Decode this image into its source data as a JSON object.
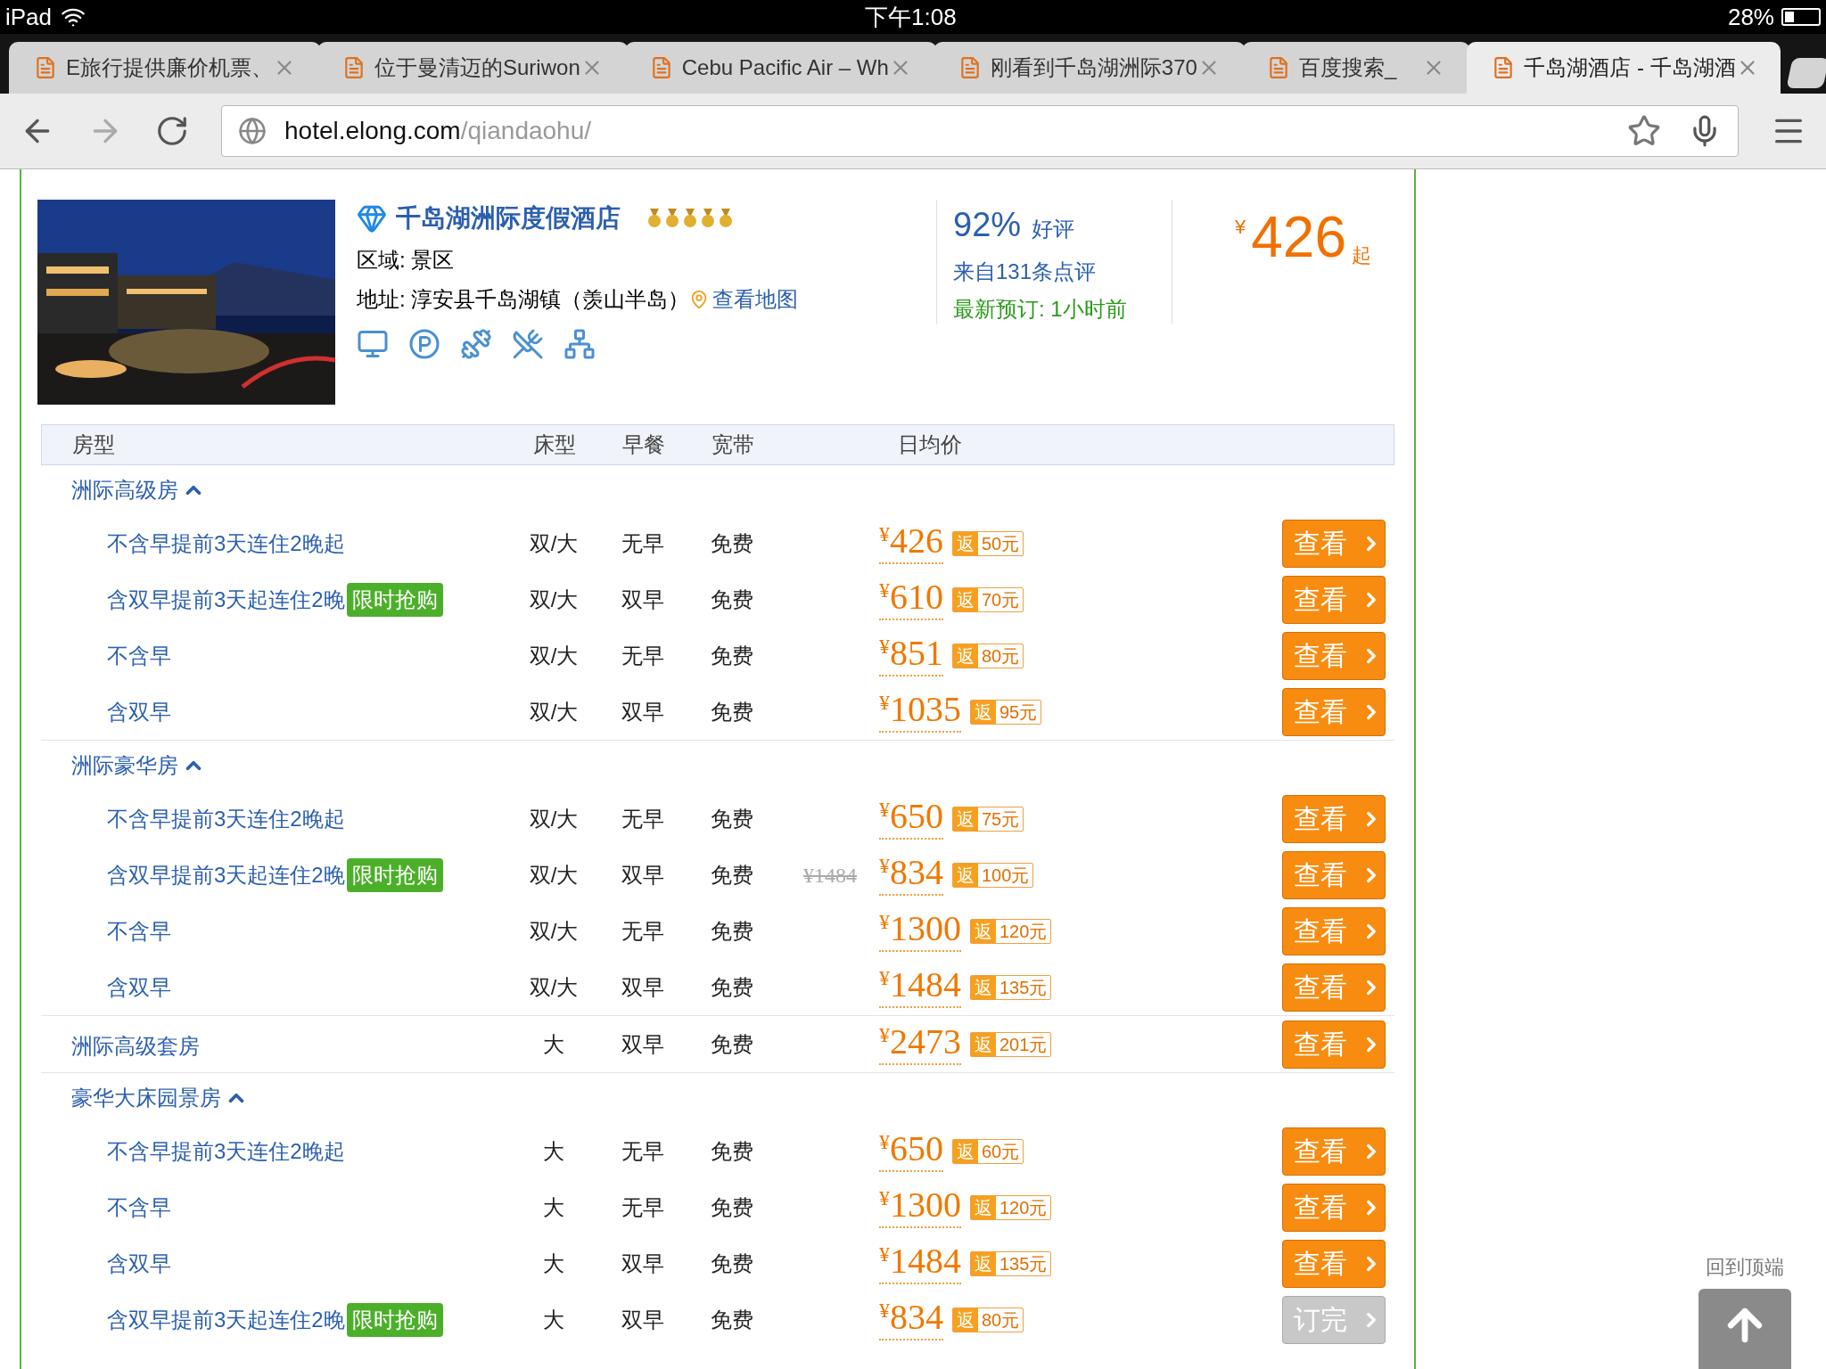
{
  "status_bar": {
    "device": "iPad",
    "time": "下午1:08",
    "battery": "28%"
  },
  "tabs": [
    {
      "title": "E旅行提供廉价机票、",
      "selected": false
    },
    {
      "title": "位于曼清迈的Suriwon",
      "selected": false
    },
    {
      "title": "Cebu Pacific Air – Wh",
      "selected": false
    },
    {
      "title": "刚看到千岛湖洲际370",
      "selected": false
    },
    {
      "title": "百度搜索_",
      "selected": false
    },
    {
      "title": "千岛湖酒店 - 千岛湖酒",
      "selected": true
    }
  ],
  "address_bar": {
    "host": "hotel.elong.com",
    "path": "/qiandaohu/"
  },
  "hotel": {
    "name": "千岛湖洲际度假酒店",
    "stars": 5,
    "area_label": "区域:",
    "area": "景区",
    "address_label": "地址:",
    "address": "淳安县千岛湖镇（羡山半岛）",
    "map_link": "查看地图",
    "rating": "92%",
    "rating_label": "好评",
    "reviews": "来自131条点评",
    "latest_booking": "最新预订: 1小时前",
    "price_symbol": "¥",
    "price": "426",
    "price_suffix": "起"
  },
  "table": {
    "columns": [
      "房型",
      "床型",
      "早餐",
      "宽带",
      "日均价"
    ],
    "groups": [
      {
        "kind": "group",
        "name": "洲际高级房",
        "expanded": true,
        "rows": [
          {
            "name": "不含早提前3天连住2晚起",
            "bed": "双/大",
            "breakfast": "无早",
            "broadband": "免费",
            "symbol": "¥",
            "price": "426",
            "rebate_label": "返",
            "rebate": "50元",
            "button": "查看",
            "disabled": false
          },
          {
            "name": "含双早提前3天起连住2晚",
            "promo": "限时抢购",
            "bed": "双/大",
            "breakfast": "双早",
            "broadband": "免费",
            "symbol": "¥",
            "price": "610",
            "rebate_label": "返",
            "rebate": "70元",
            "button": "查看",
            "disabled": false
          },
          {
            "name": "不含早",
            "bed": "双/大",
            "breakfast": "无早",
            "broadband": "免费",
            "symbol": "¥",
            "price": "851",
            "rebate_label": "返",
            "rebate": "80元",
            "button": "查看",
            "disabled": false
          },
          {
            "name": "含双早",
            "bed": "双/大",
            "breakfast": "双早",
            "broadband": "免费",
            "symbol": "¥",
            "price": "1035",
            "rebate_label": "返",
            "rebate": "95元",
            "button": "查看",
            "disabled": false
          }
        ]
      },
      {
        "kind": "group",
        "name": "洲际豪华房",
        "expanded": true,
        "rows": [
          {
            "name": "不含早提前3天连住2晚起",
            "bed": "双/大",
            "breakfast": "无早",
            "broadband": "免费",
            "symbol": "¥",
            "price": "650",
            "rebate_label": "返",
            "rebate": "75元",
            "button": "查看",
            "disabled": false
          },
          {
            "name": "含双早提前3天起连住2晚",
            "promo": "限时抢购",
            "bed": "双/大",
            "breakfast": "双早",
            "broadband": "免费",
            "original_price": "¥1484",
            "symbol": "¥",
            "price": "834",
            "rebate_label": "返",
            "rebate": "100元",
            "button": "查看",
            "disabled": false
          },
          {
            "name": "不含早",
            "bed": "双/大",
            "breakfast": "无早",
            "broadband": "免费",
            "symbol": "¥",
            "price": "1300",
            "rebate_label": "返",
            "rebate": "120元",
            "button": "查看",
            "disabled": false
          },
          {
            "name": "含双早",
            "bed": "双/大",
            "breakfast": "双早",
            "broadband": "免费",
            "symbol": "¥",
            "price": "1484",
            "rebate_label": "返",
            "rebate": "135元",
            "button": "查看",
            "disabled": false
          }
        ]
      },
      {
        "kind": "single",
        "name": "洲际高级套房",
        "rows": [
          {
            "bed": "大",
            "breakfast": "双早",
            "broadband": "免费",
            "symbol": "¥",
            "price": "2473",
            "rebate_label": "返",
            "rebate": "201元",
            "button": "查看",
            "disabled": false
          }
        ]
      },
      {
        "kind": "group",
        "name": "豪华大床园景房",
        "expanded": true,
        "rows": [
          {
            "name": "不含早提前3天连住2晚起",
            "bed": "大",
            "breakfast": "无早",
            "broadband": "免费",
            "symbol": "¥",
            "price": "650",
            "rebate_label": "返",
            "rebate": "60元",
            "button": "查看",
            "disabled": false
          },
          {
            "name": "不含早",
            "bed": "大",
            "breakfast": "无早",
            "broadband": "免费",
            "symbol": "¥",
            "price": "1300",
            "rebate_label": "返",
            "rebate": "120元",
            "button": "查看",
            "disabled": false
          },
          {
            "name": "含双早",
            "bed": "大",
            "breakfast": "双早",
            "broadband": "免费",
            "symbol": "¥",
            "price": "1484",
            "rebate_label": "返",
            "rebate": "135元",
            "button": "查看",
            "disabled": false
          },
          {
            "name": "含双早提前3天起连住2晚",
            "promo": "限时抢购",
            "bed": "大",
            "breakfast": "双早",
            "broadband": "免费",
            "symbol": "¥",
            "price": "834",
            "rebate_label": "返",
            "rebate": "80元",
            "button": "订完",
            "disabled": true
          }
        ]
      }
    ]
  },
  "back_to_top": "回到顶端"
}
